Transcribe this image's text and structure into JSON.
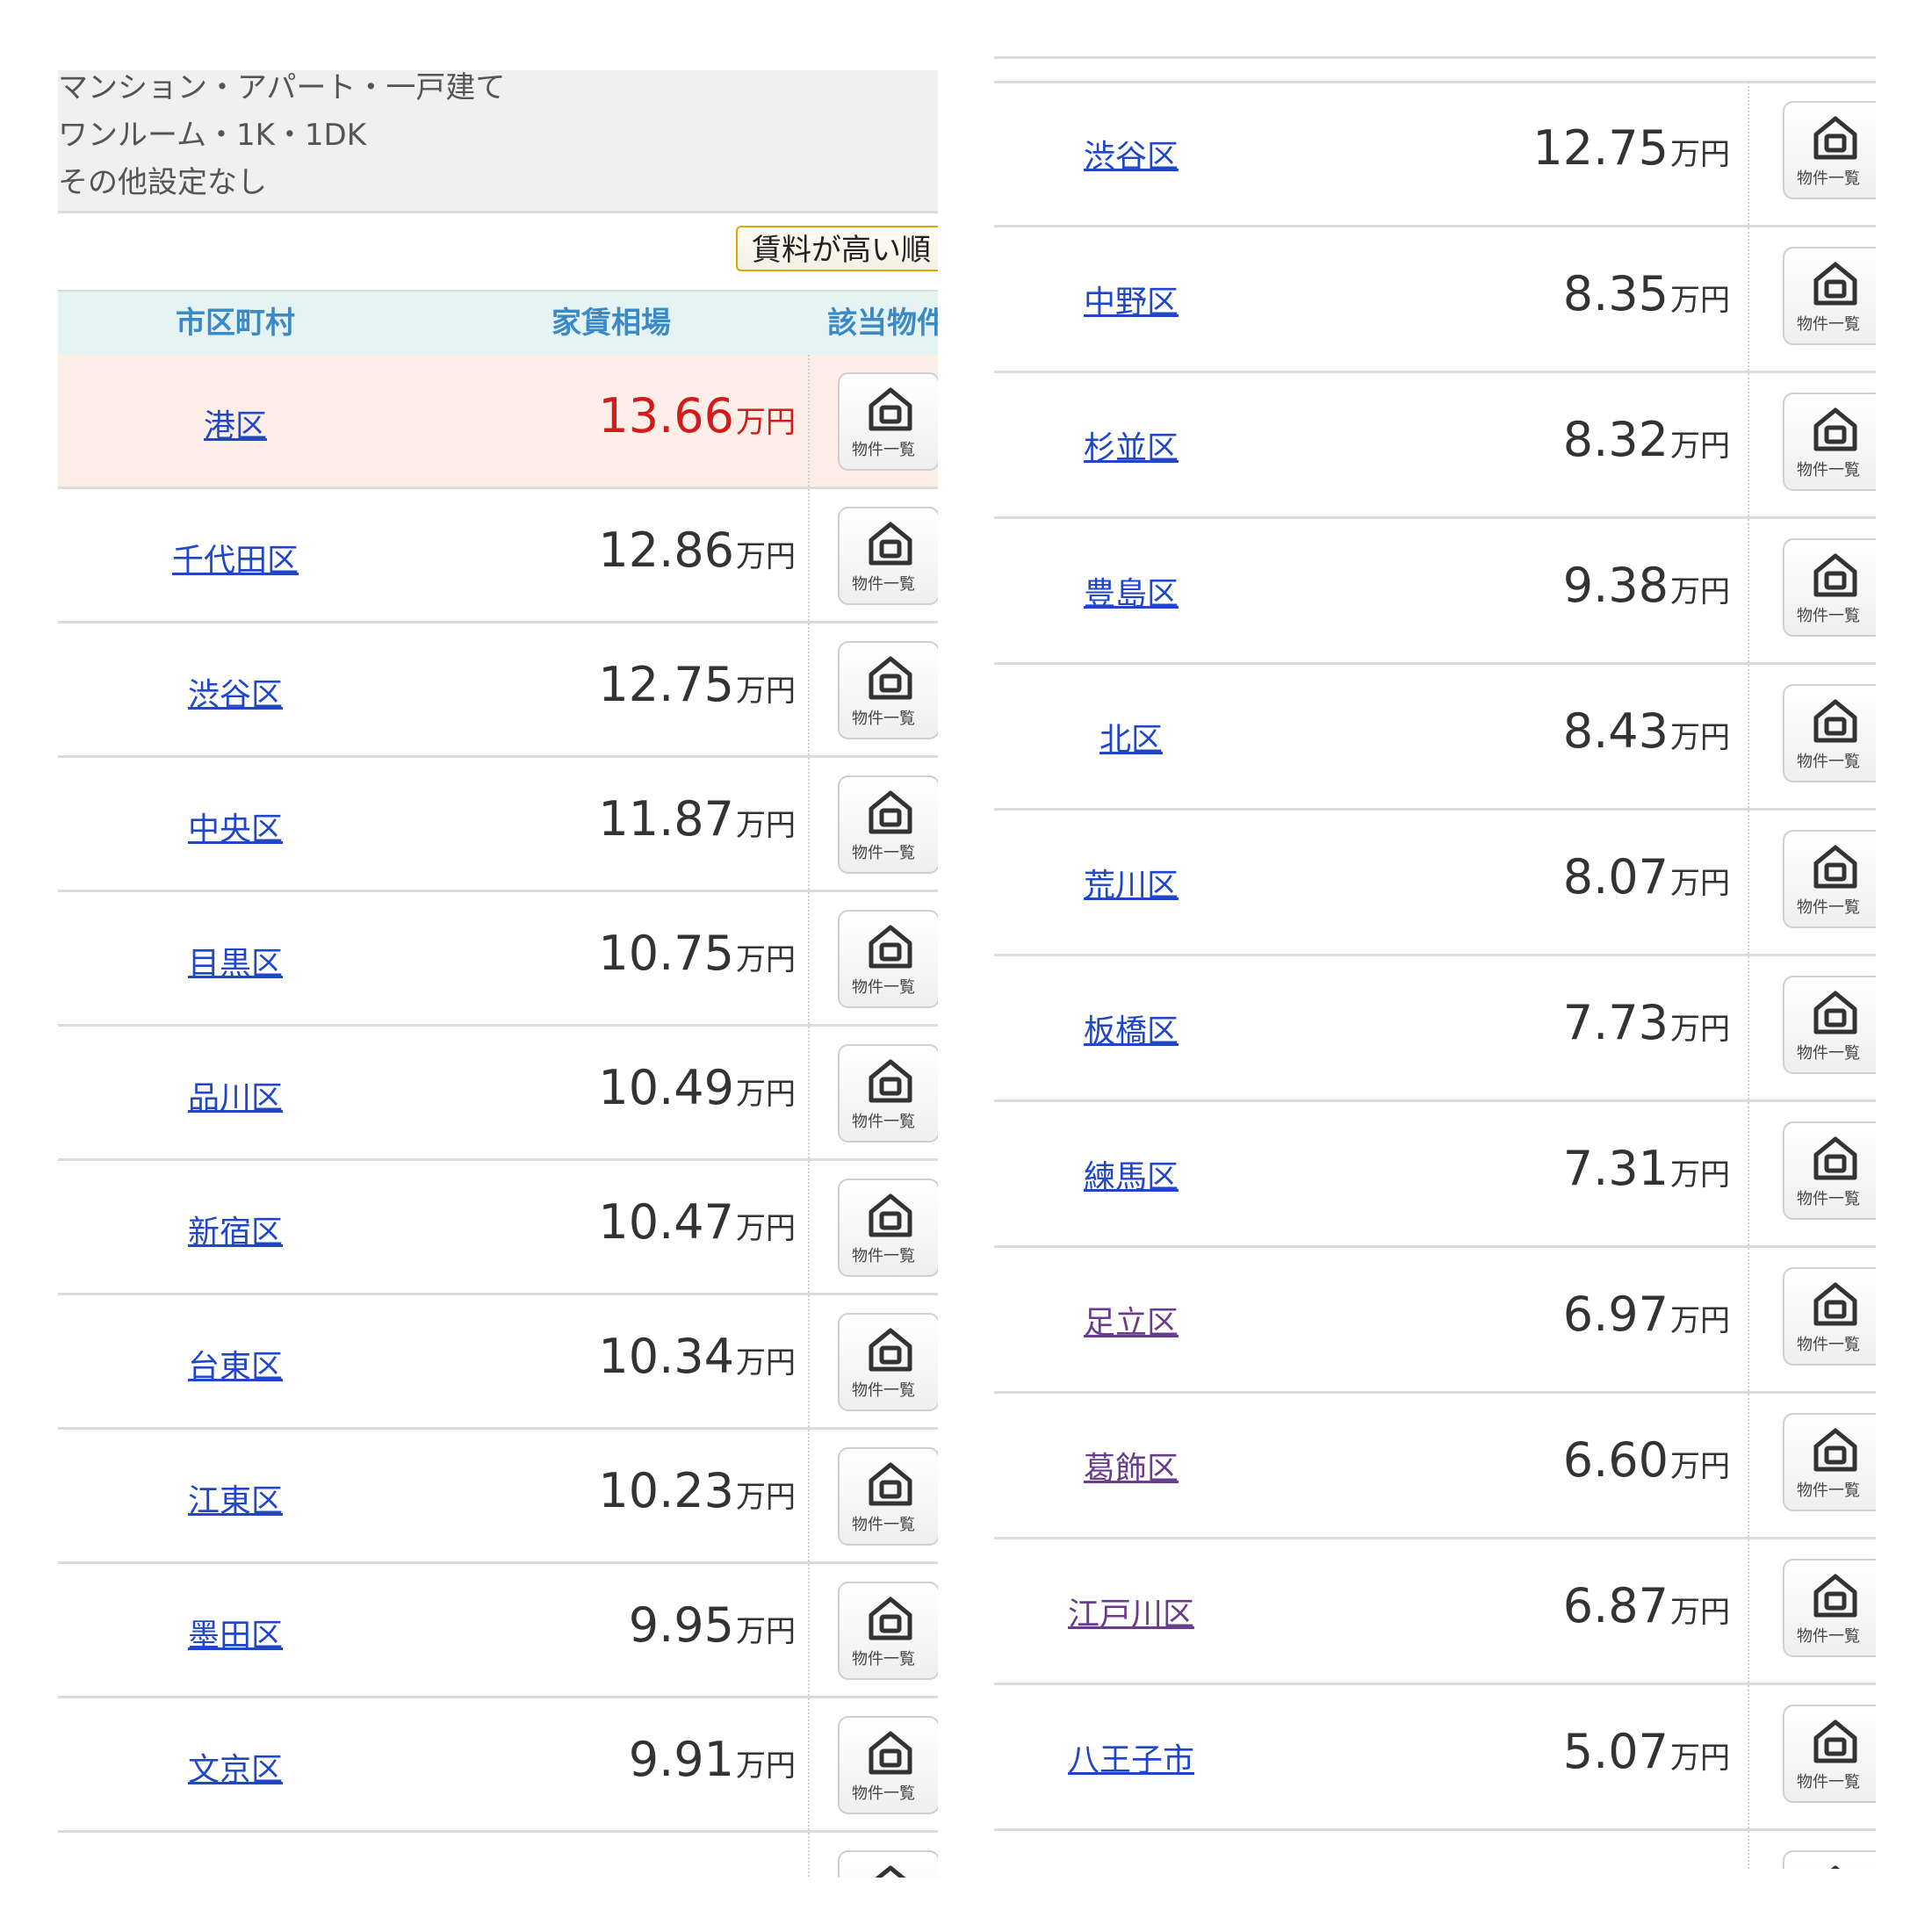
{
  "filters": {
    "lines": [
      "マンション・アパート・一戸建て",
      "ワンルーム・1K・1DK",
      "その他設定なし"
    ]
  },
  "sort_button": {
    "label": "賃料が高い順"
  },
  "table_header": {
    "city": "市区町村",
    "rent": "家賃相場",
    "properties": "該当物件"
  },
  "rent_unit": "万円",
  "property_button_label": "物件一覧",
  "left_rows": [
    {
      "city": "港区",
      "rent": "13.66",
      "highlight": true
    },
    {
      "city": "千代田区",
      "rent": "12.86"
    },
    {
      "city": "渋谷区",
      "rent": "12.75"
    },
    {
      "city": "中央区",
      "rent": "11.87"
    },
    {
      "city": "目黒区",
      "rent": "10.75"
    },
    {
      "city": "品川区",
      "rent": "10.49"
    },
    {
      "city": "新宿区",
      "rent": "10.47"
    },
    {
      "city": "台東区",
      "rent": "10.34"
    },
    {
      "city": "江東区",
      "rent": "10.23"
    },
    {
      "city": "墨田区",
      "rent": "9.95"
    },
    {
      "city": "文京区",
      "rent": "9.91"
    },
    {
      "city": "",
      "rent": ""
    }
  ],
  "right_rows": [
    {
      "city": "渋谷区",
      "rent": "12.75"
    },
    {
      "city": "中野区",
      "rent": "8.35"
    },
    {
      "city": "杉並区",
      "rent": "8.32"
    },
    {
      "city": "豊島区",
      "rent": "9.38"
    },
    {
      "city": "北区",
      "rent": "8.43"
    },
    {
      "city": "荒川区",
      "rent": "8.07"
    },
    {
      "city": "板橋区",
      "rent": "7.73"
    },
    {
      "city": "練馬区",
      "rent": "7.31"
    },
    {
      "city": "足立区",
      "rent": "6.97",
      "visited": true
    },
    {
      "city": "葛飾区",
      "rent": "6.60",
      "visited": true
    },
    {
      "city": "江戸川区",
      "rent": "6.87",
      "visited": true
    },
    {
      "city": "八王子市",
      "rent": "5.07"
    },
    {
      "city": "",
      "rent": ""
    }
  ]
}
